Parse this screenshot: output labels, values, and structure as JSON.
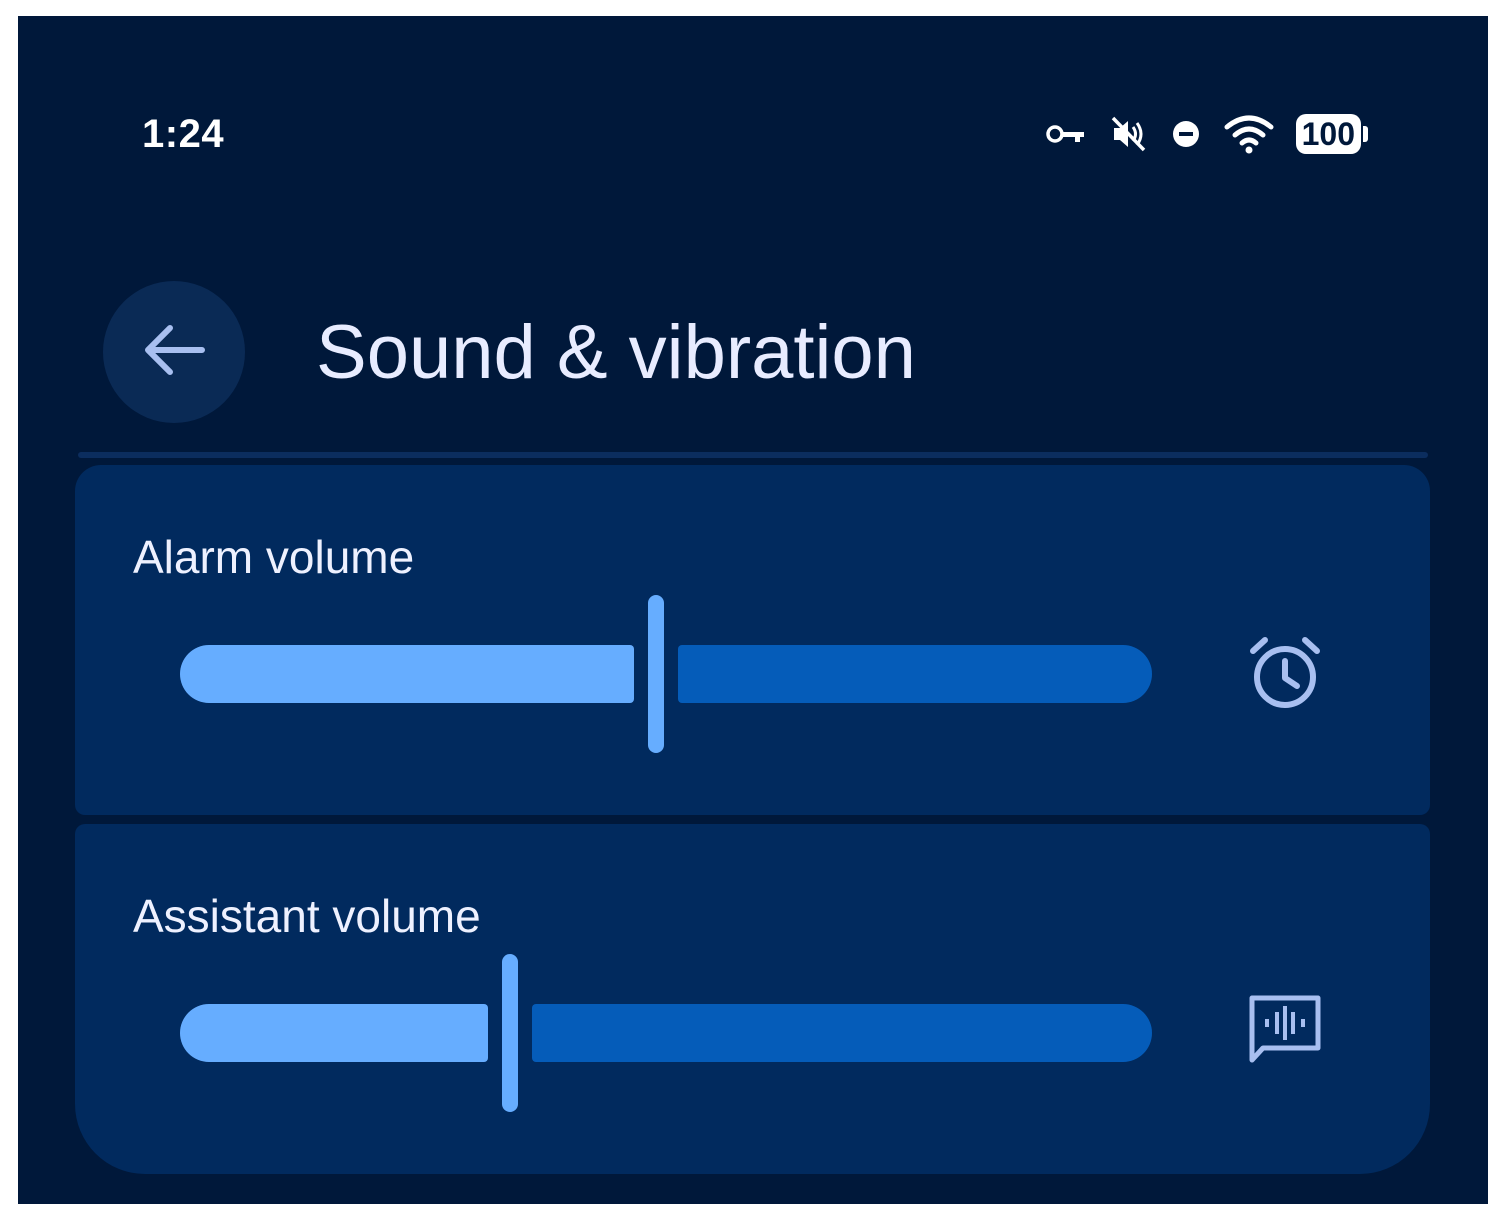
{
  "status_bar": {
    "time": "1:24",
    "battery_level": "100",
    "icons": [
      "vpn-key-icon",
      "vibrate-off-icon",
      "do-not-disturb-icon",
      "wifi-icon",
      "battery-icon"
    ]
  },
  "header": {
    "back_icon": "arrow-left-icon",
    "title": "Sound & vibration"
  },
  "volume_rows": [
    {
      "label": "Alarm volume",
      "level": 0.49,
      "icon": "alarm-clock-icon"
    },
    {
      "label": "Assistant volume",
      "level": 0.34,
      "icon": "assistant-voice-icon"
    }
  ],
  "colors": {
    "background": "#00183a",
    "card": "#012a5e",
    "track_active": "#66adff",
    "track_inactive": "#055cb9",
    "icon_tint": "#a8bff0"
  }
}
